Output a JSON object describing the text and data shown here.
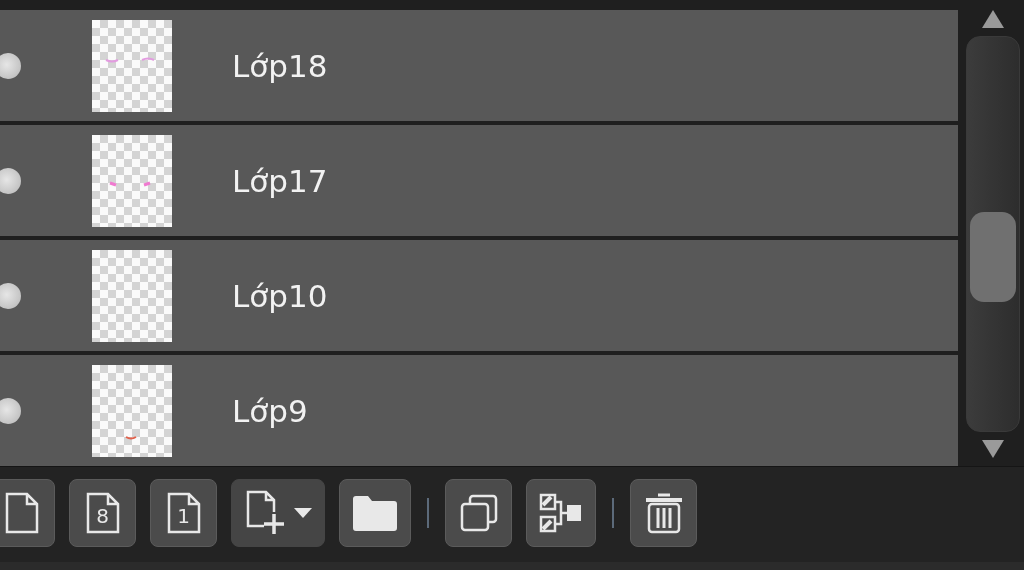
{
  "layers": [
    {
      "name": "Lớp18"
    },
    {
      "name": "Lớp17"
    },
    {
      "name": "Lớp10"
    },
    {
      "name": "Lớp9"
    }
  ],
  "toolbar": [
    {
      "kind": "page"
    },
    {
      "kind": "numbered-page",
      "glyph": "8"
    },
    {
      "kind": "numbered-page",
      "glyph": "1"
    },
    {
      "kind": "add-dropdown"
    },
    {
      "kind": "folder"
    },
    {
      "kind": "separator"
    },
    {
      "kind": "duplicate"
    },
    {
      "kind": "merge"
    },
    {
      "kind": "separator"
    },
    {
      "kind": "delete"
    }
  ]
}
